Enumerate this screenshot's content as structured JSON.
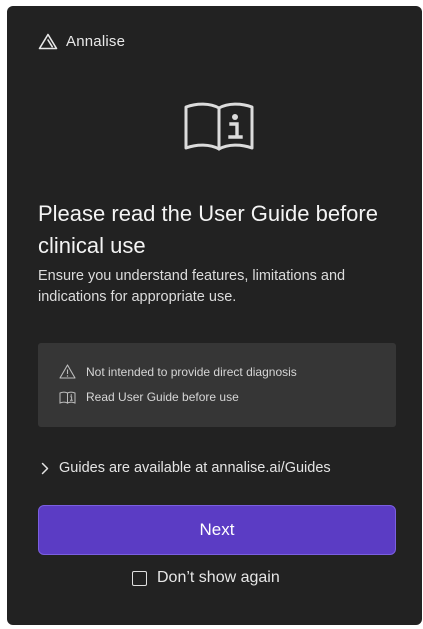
{
  "brand": {
    "name": "Annalise",
    "icon": "annalise-logo-icon"
  },
  "hero": {
    "icon": "user-guide-book-info-icon"
  },
  "title": "Please read the User Guide before clinical use",
  "subtitle": "Ensure you understand features, limitations and indications for appropriate use.",
  "notices": [
    {
      "icon": "warning-triangle-icon",
      "text": "Not intended to provide direct diagnosis"
    },
    {
      "icon": "book-info-icon",
      "text": "Read User Guide before use"
    }
  ],
  "guides_link": {
    "icon": "chevron-right-icon",
    "text": "Guides are available at annalise.ai/Guides"
  },
  "next_button": {
    "label": "Next"
  },
  "dont_show": {
    "label": "Don’t show again",
    "checked": false
  },
  "colors": {
    "background": "#222222",
    "notice_background": "#363636",
    "accent": "#5b3cc4",
    "text": "#f0f0f0"
  }
}
